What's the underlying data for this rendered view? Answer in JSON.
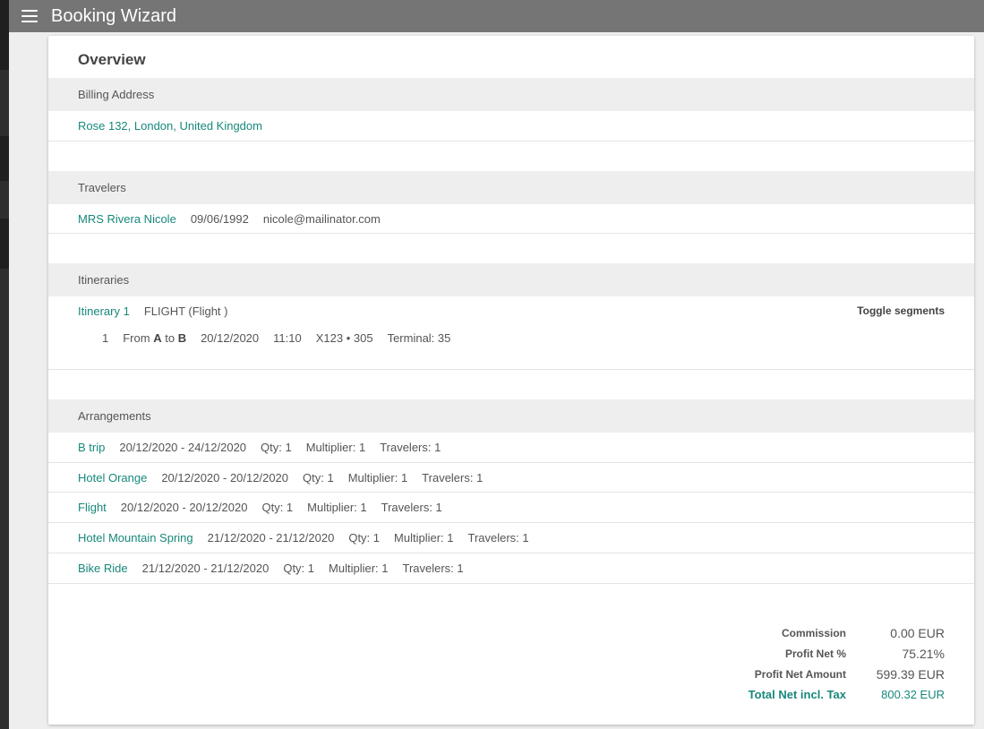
{
  "app": {
    "title": "Booking Wizard"
  },
  "overview": {
    "title": "Overview"
  },
  "billing": {
    "heading": "Billing Address",
    "address": "Rose 132, London, United Kingdom"
  },
  "travelers": {
    "heading": "Travelers",
    "items": [
      {
        "name": "MRS Rivera Nicole",
        "dob": "09/06/1992",
        "email": "nicole@mailinator.com"
      }
    ]
  },
  "itineraries": {
    "heading": "Itineraries",
    "toggle_label": "Toggle segments",
    "items": [
      {
        "name": "Itinerary 1",
        "type": "FLIGHT (Flight )",
        "segments": [
          {
            "index": "1",
            "from_label": "From",
            "from": "A",
            "to_label": "to",
            "to": "B",
            "date": "20/12/2020",
            "time": "11:10",
            "flight": "X123 • 305",
            "terminal": "Terminal: 35"
          }
        ]
      }
    ]
  },
  "arrangements": {
    "heading": "Arrangements",
    "items": [
      {
        "name": "B trip",
        "dates": "20/12/2020 - 24/12/2020",
        "qty": "Qty: 1",
        "multiplier": "Multiplier: 1",
        "travelers": "Travelers: 1"
      },
      {
        "name": "Hotel Orange",
        "dates": "20/12/2020 - 20/12/2020",
        "qty": "Qty: 1",
        "multiplier": "Multiplier: 1",
        "travelers": "Travelers: 1"
      },
      {
        "name": "Flight",
        "dates": "20/12/2020 - 20/12/2020",
        "qty": "Qty: 1",
        "multiplier": "Multiplier: 1",
        "travelers": "Travelers: 1"
      },
      {
        "name": "Hotel Mountain Spring",
        "dates": "21/12/2020 - 21/12/2020",
        "qty": "Qty: 1",
        "multiplier": "Multiplier: 1",
        "travelers": "Travelers: 1"
      },
      {
        "name": "Bike Ride",
        "dates": "21/12/2020 - 21/12/2020",
        "qty": "Qty: 1",
        "multiplier": "Multiplier: 1",
        "travelers": "Travelers: 1"
      }
    ]
  },
  "totals": {
    "commission": {
      "label": "Commission",
      "value": "0.00 EUR"
    },
    "profit_pct": {
      "label": "Profit Net %",
      "value": "75.21%"
    },
    "profit_amount": {
      "label": "Profit Net Amount",
      "value": "599.39 EUR"
    },
    "total": {
      "label": "Total Net incl. Tax",
      "value": "800.32 EUR"
    }
  },
  "colors": {
    "accent": "#17887b",
    "topbar": "#757575",
    "section_bg": "#eeeeee"
  },
  "icons": {
    "menu": "hamburger-menu-icon"
  }
}
